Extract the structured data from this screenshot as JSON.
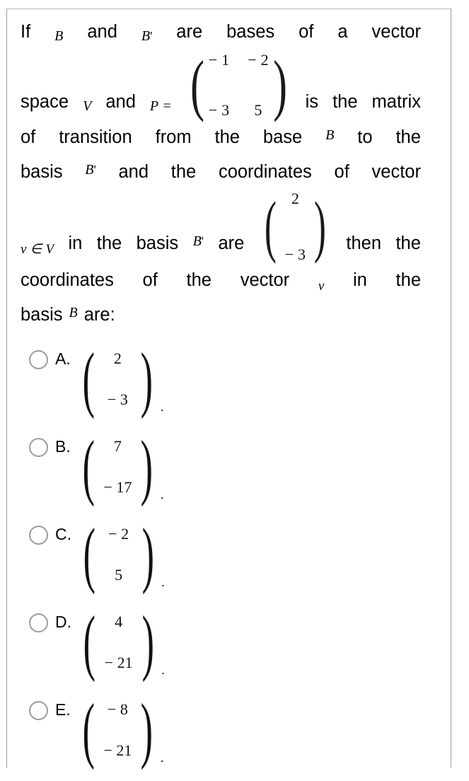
{
  "document": {
    "type": "multiple-choice-question",
    "subject_notation": "linear-algebra"
  },
  "question": {
    "lines": [
      {
        "id": "line1",
        "parts": [
          {
            "kind": "text",
            "value": "If"
          },
          {
            "kind": "math",
            "value": "B"
          },
          {
            "kind": "text",
            "value": "and"
          },
          {
            "kind": "math",
            "value": "B'"
          },
          {
            "kind": "text",
            "value": "are"
          },
          {
            "kind": "text",
            "value": "bases"
          },
          {
            "kind": "text",
            "value": "of"
          },
          {
            "kind": "text",
            "value": "a"
          },
          {
            "kind": "text",
            "value": "vector"
          }
        ]
      },
      {
        "id": "line2",
        "parts": [
          {
            "kind": "text",
            "value": "space"
          },
          {
            "kind": "math",
            "value": "V"
          },
          {
            "kind": "text",
            "value": "and"
          },
          {
            "kind": "math",
            "value": "P ="
          },
          {
            "kind": "matrix2x2",
            "value": [
              "− 1",
              "− 2",
              "− 3",
              "5"
            ]
          },
          {
            "kind": "text",
            "value": "is"
          },
          {
            "kind": "text",
            "value": "the"
          },
          {
            "kind": "text",
            "value": "matrix"
          }
        ]
      },
      {
        "id": "line3",
        "parts": [
          {
            "kind": "text",
            "value": "of"
          },
          {
            "kind": "text",
            "value": "transition"
          },
          {
            "kind": "text",
            "value": "from"
          },
          {
            "kind": "text",
            "value": "the"
          },
          {
            "kind": "text",
            "value": "base"
          },
          {
            "kind": "math",
            "value": "B"
          },
          {
            "kind": "text",
            "value": "to"
          },
          {
            "kind": "text",
            "value": "the"
          }
        ]
      },
      {
        "id": "line4",
        "parts": [
          {
            "kind": "text",
            "value": "basis"
          },
          {
            "kind": "math",
            "value": "B'"
          },
          {
            "kind": "text",
            "value": "and"
          },
          {
            "kind": "text",
            "value": "the"
          },
          {
            "kind": "text",
            "value": "coordinates"
          },
          {
            "kind": "text",
            "value": "of"
          },
          {
            "kind": "text",
            "value": "vector"
          }
        ]
      },
      {
        "id": "line5",
        "parts": [
          {
            "kind": "math",
            "value": "v ∈ V"
          },
          {
            "kind": "text",
            "value": "in"
          },
          {
            "kind": "text",
            "value": "the"
          },
          {
            "kind": "text",
            "value": "basis"
          },
          {
            "kind": "math",
            "value": "B'"
          },
          {
            "kind": "text",
            "value": "are"
          },
          {
            "kind": "colvec",
            "value": [
              "2",
              "− 3"
            ]
          },
          {
            "kind": "text",
            "value": "then"
          },
          {
            "kind": "text",
            "value": "the"
          }
        ]
      },
      {
        "id": "line6",
        "parts": [
          {
            "kind": "text",
            "value": "coordinates"
          },
          {
            "kind": "text",
            "value": "of"
          },
          {
            "kind": "text",
            "value": "the"
          },
          {
            "kind": "text",
            "value": "vector"
          },
          {
            "kind": "math",
            "value": "v"
          },
          {
            "kind": "text",
            "value": "in"
          },
          {
            "kind": "text",
            "value": "the"
          }
        ]
      },
      {
        "id": "line7",
        "parts": [
          {
            "kind": "text",
            "value": "basis"
          },
          {
            "kind": "math",
            "value": "B"
          },
          {
            "kind": "text",
            "value": "are:"
          }
        ]
      }
    ],
    "words": {
      "if": "If",
      "and": "and",
      "are": "are",
      "bases": "bases",
      "of": "of",
      "a": "a",
      "vector": "vector",
      "space": "space",
      "is": "is",
      "the": "the",
      "matrix": "matrix",
      "transition": "transition",
      "from": "from",
      "base": "base",
      "to": "to",
      "basis": "basis",
      "coordinates": "coordinates",
      "in": "in",
      "then": "then",
      "are_colon": "are:"
    },
    "symbols": {
      "B": "B",
      "Bprime_letter": "B",
      "prime": "'",
      "V": "V",
      "v": "v",
      "v_in_V": "v ∈ V",
      "P_eq": "P ="
    },
    "P_matrix": {
      "rows": [
        [
          "− 1",
          "− 2"
        ],
        [
          "− 3",
          "5"
        ]
      ]
    },
    "given_vector": {
      "rows": [
        "2",
        "− 3"
      ]
    }
  },
  "options": [
    {
      "letter": "A.",
      "vector": [
        "2",
        "− 3"
      ],
      "trailing": ".",
      "selected": false
    },
    {
      "letter": "B.",
      "vector": [
        "7",
        "− 17"
      ],
      "trailing": ".",
      "selected": false
    },
    {
      "letter": "C.",
      "vector": [
        "− 2",
        "5"
      ],
      "trailing": ".",
      "selected": false
    },
    {
      "letter": "D.",
      "vector": [
        "4",
        "− 21"
      ],
      "trailing": ".",
      "selected": false
    },
    {
      "letter": "E.",
      "vector": [
        "− 8",
        "− 21"
      ],
      "trailing": ".",
      "selected": false
    }
  ],
  "glyphs": {
    "paren_open": "(",
    "paren_close": ")"
  },
  "colors": {
    "text": "#000000",
    "border": "#9a9a9a",
    "radio_border": "#9b9b9b",
    "background": "#ffffff"
  }
}
